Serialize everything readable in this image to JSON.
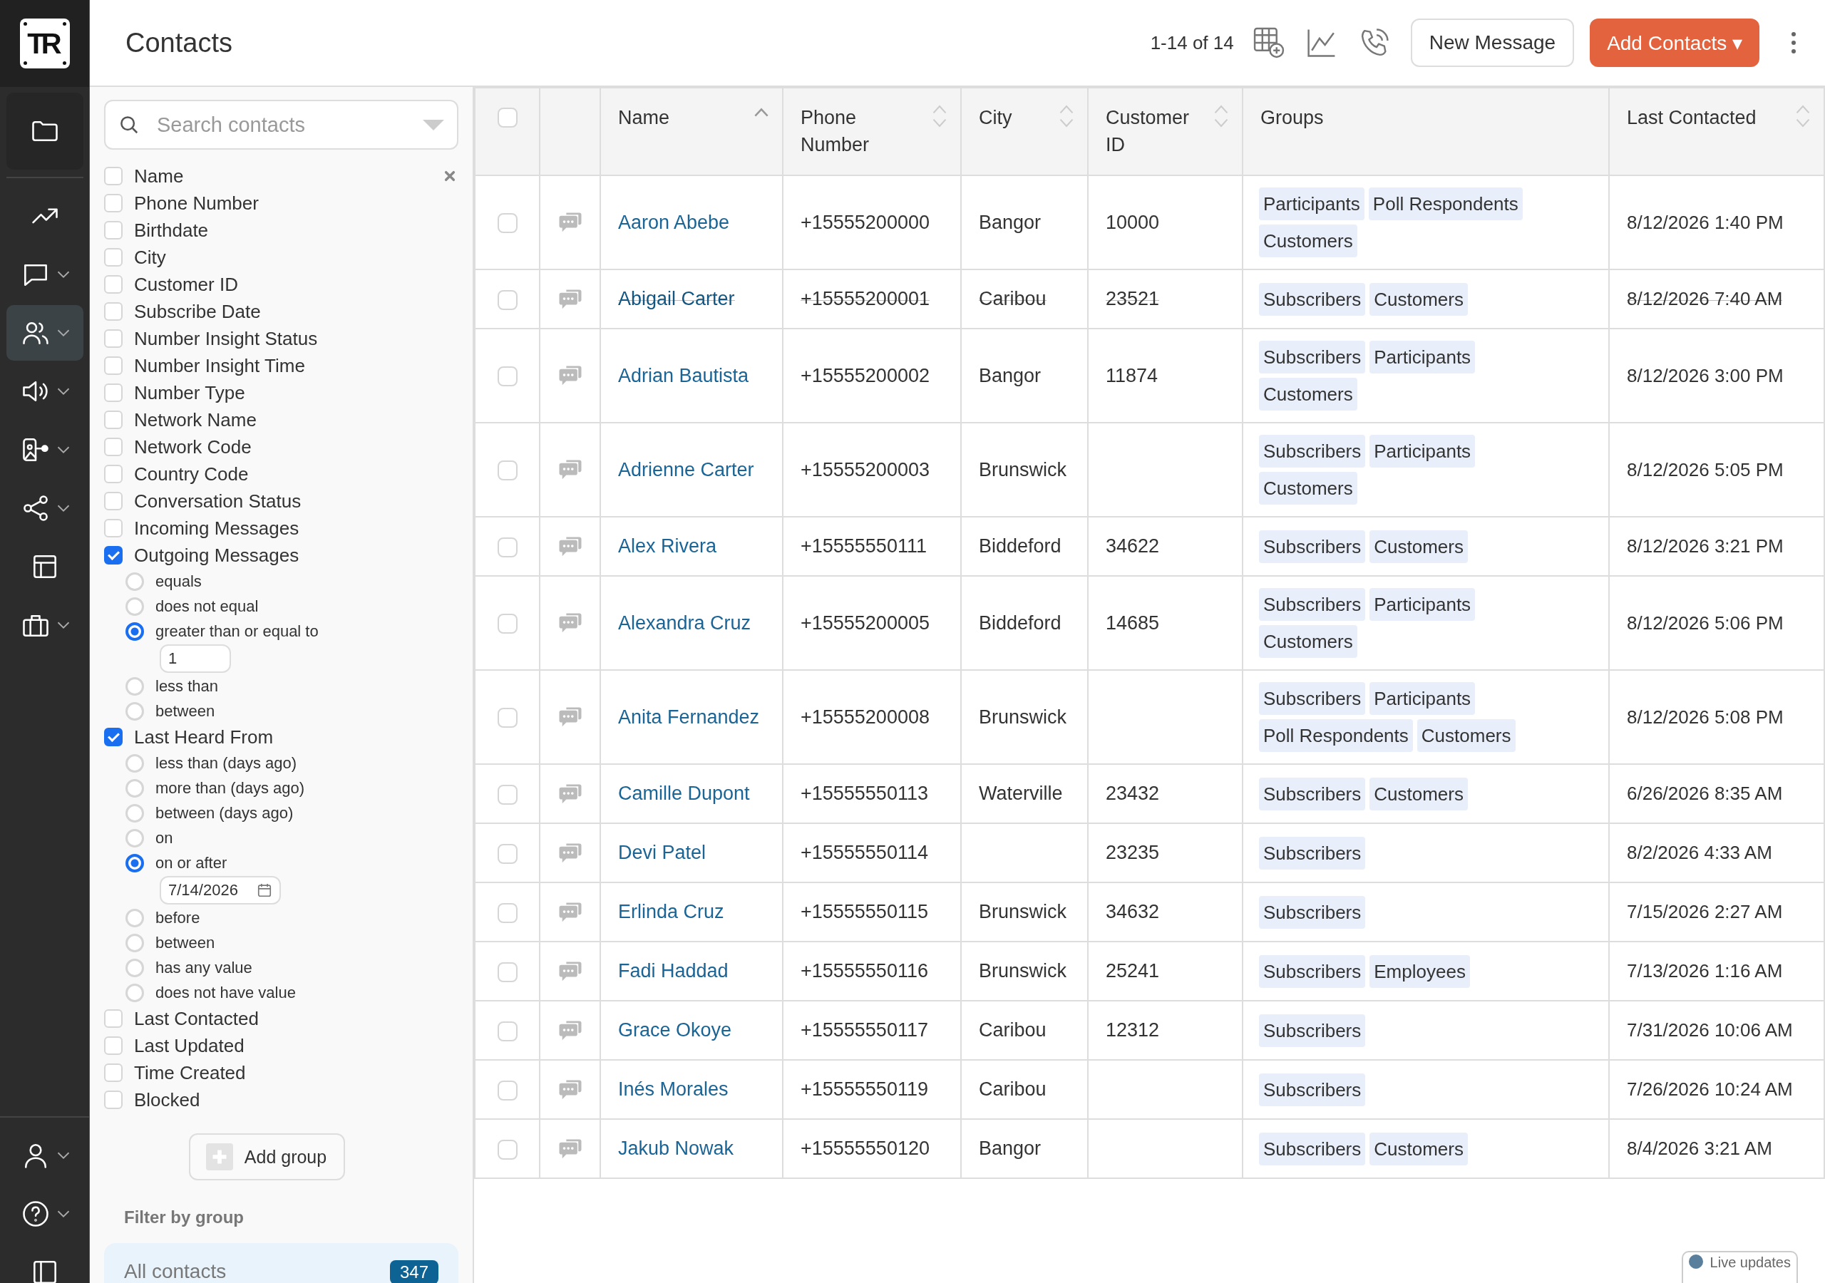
{
  "logo": "TR",
  "nav": [
    {
      "kind": "folder",
      "selected": false,
      "dropdown": false
    },
    {
      "kind": "trend",
      "selected": false,
      "dropdown": false
    },
    {
      "kind": "chat",
      "selected": false,
      "dropdown": true
    },
    {
      "kind": "people",
      "selected": true,
      "dropdown": true
    },
    {
      "kind": "speaker",
      "selected": false,
      "dropdown": true
    },
    {
      "kind": "board",
      "selected": false,
      "dropdown": true
    },
    {
      "kind": "share",
      "selected": false,
      "dropdown": true
    },
    {
      "kind": "table",
      "selected": false,
      "dropdown": false
    },
    {
      "kind": "briefcase",
      "selected": false,
      "dropdown": true
    }
  ],
  "nav_bottom": [
    {
      "kind": "user",
      "dropdown": true
    },
    {
      "kind": "help",
      "dropdown": true
    },
    {
      "kind": "panel",
      "dropdown": false
    }
  ],
  "header": {
    "title": "Contacts",
    "count": "1-14 of 14",
    "buttons": [
      {
        "label": "New Message",
        "kind": "secondary"
      },
      {
        "label": "Add Contacts ▾",
        "kind": "primary"
      }
    ]
  },
  "filters": {
    "search": {
      "placeholder": "Search contacts"
    },
    "fields": [
      {
        "label": "Name",
        "checked": false
      },
      {
        "label": "Phone Number",
        "checked": false
      },
      {
        "label": "Birthdate",
        "checked": false
      },
      {
        "label": "City",
        "checked": false
      },
      {
        "label": "Customer ID",
        "checked": false
      },
      {
        "label": "Subscribe Date",
        "checked": false
      },
      {
        "label": "Number Insight Status",
        "checked": false
      },
      {
        "label": "Number Insight Time",
        "checked": false
      },
      {
        "label": "Number Type",
        "checked": false
      },
      {
        "label": "Network Name",
        "checked": false
      },
      {
        "label": "Network Code",
        "checked": false
      },
      {
        "label": "Country Code",
        "checked": false
      },
      {
        "label": "Conversation Status",
        "checked": false
      },
      {
        "label": "Incoming Messages",
        "checked": false
      },
      {
        "label": "Outgoing Messages",
        "checked": true,
        "options": [
          {
            "label": "equals",
            "selected": false
          },
          {
            "label": "does not equal",
            "selected": false
          },
          {
            "label": "greater than or equal to",
            "selected": true,
            "input": {
              "kind": "number",
              "value": "1"
            }
          },
          {
            "label": "less than",
            "selected": false
          },
          {
            "label": "between",
            "selected": false
          }
        ]
      },
      {
        "label": "Last Heard From",
        "checked": true,
        "options": [
          {
            "label": "less than (days ago)",
            "selected": false
          },
          {
            "label": "more than (days ago)",
            "selected": false
          },
          {
            "label": "between (days ago)",
            "selected": false
          },
          {
            "label": "on",
            "selected": false
          },
          {
            "label": "on or after",
            "selected": true,
            "input": {
              "kind": "date",
              "value": "7/14/2026"
            }
          },
          {
            "label": "before",
            "selected": false
          },
          {
            "label": "between",
            "selected": false
          },
          {
            "label": "has any value",
            "selected": false
          },
          {
            "label": "does not have value",
            "selected": false
          }
        ]
      },
      {
        "label": "Last Contacted",
        "checked": false
      },
      {
        "label": "Last Updated",
        "checked": false
      },
      {
        "label": "Time Created",
        "checked": false
      },
      {
        "label": "Blocked",
        "checked": false
      }
    ],
    "add_group": "Add group",
    "group_heading": "Filter by group",
    "groups": [
      {
        "label": "All contacts",
        "count": "347",
        "selected": true
      }
    ]
  },
  "table": {
    "all_checked": false,
    "columns": [
      {
        "label": "Name",
        "sorted": true
      },
      {
        "label": "Phone Number",
        "sorted": false
      },
      {
        "label": "City",
        "sorted": false
      },
      {
        "label": "Customer ID",
        "sorted": false
      },
      {
        "label": "Groups"
      },
      {
        "label": "Last Contacted",
        "sorted": false
      }
    ],
    "rows": [
      {
        "checked": false,
        "blocked": false,
        "name": "Aaron Abebe",
        "phone": "+15555200000",
        "city": "Bangor",
        "customer_id": "10000",
        "groups": [
          "Participants",
          "Poll Respondents",
          "Customers"
        ],
        "last_contacted": "8/12/2026 1:40 PM"
      },
      {
        "checked": false,
        "blocked": true,
        "name": "Abigail Carter",
        "phone": "+15555200001",
        "city": "Caribou",
        "customer_id": "23521",
        "groups": [
          "Subscribers",
          "Customers"
        ],
        "last_contacted": "8/12/2026 7:40 AM"
      },
      {
        "checked": false,
        "blocked": false,
        "name": "Adrian Bautista",
        "phone": "+15555200002",
        "city": "Bangor",
        "customer_id": "11874",
        "groups": [
          "Subscribers",
          "Participants",
          "Customers"
        ],
        "last_contacted": "8/12/2026 3:00 PM"
      },
      {
        "checked": false,
        "blocked": false,
        "name": "Adrienne Carter",
        "phone": "+15555200003",
        "city": "Brunswick",
        "groups": [
          "Subscribers",
          "Participants",
          "Customers"
        ],
        "last_contacted": "8/12/2026 5:05 PM"
      },
      {
        "checked": false,
        "blocked": false,
        "name": "Alex Rivera",
        "phone": "+15555550111",
        "city": "Biddeford",
        "customer_id": "34622",
        "groups": [
          "Subscribers",
          "Customers"
        ],
        "last_contacted": "8/12/2026 3:21 PM"
      },
      {
        "checked": false,
        "blocked": false,
        "name": "Alexandra Cruz",
        "phone": "+15555200005",
        "city": "Biddeford",
        "customer_id": "14685",
        "groups": [
          "Subscribers",
          "Participants",
          "Customers"
        ],
        "last_contacted": "8/12/2026 5:06 PM"
      },
      {
        "checked": false,
        "blocked": false,
        "name": "Anita Fernandez",
        "phone": "+15555200008",
        "city": "Brunswick",
        "groups": [
          "Subscribers",
          "Participants",
          "Poll Respondents",
          "Customers"
        ],
        "last_contacted": "8/12/2026 5:08 PM"
      },
      {
        "checked": false,
        "blocked": false,
        "name": "Camille Dupont",
        "phone": "+15555550113",
        "city": "Waterville",
        "customer_id": "23432",
        "groups": [
          "Subscribers",
          "Customers"
        ],
        "last_contacted": "6/26/2026 8:35 AM"
      },
      {
        "checked": false,
        "blocked": false,
        "name": "Devi Patel",
        "phone": "+15555550114",
        "customer_id": "23235",
        "groups": [
          "Subscribers"
        ],
        "last_contacted": "8/2/2026 4:33 AM"
      },
      {
        "checked": false,
        "blocked": false,
        "name": "Erlinda Cruz",
        "phone": "+15555550115",
        "city": "Brunswick",
        "customer_id": "34632",
        "groups": [
          "Subscribers"
        ],
        "last_contacted": "7/15/2026 2:27 AM"
      },
      {
        "checked": false,
        "blocked": false,
        "name": "Fadi Haddad",
        "phone": "+15555550116",
        "city": "Brunswick",
        "customer_id": "25241",
        "groups": [
          "Subscribers",
          "Employees"
        ],
        "last_contacted": "7/13/2026 1:16 AM"
      },
      {
        "checked": false,
        "blocked": false,
        "name": "Grace Okoye",
        "phone": "+15555550117",
        "city": "Caribou",
        "customer_id": "12312",
        "groups": [
          "Subscribers"
        ],
        "last_contacted": "7/31/2026 10:06 AM"
      },
      {
        "checked": false,
        "blocked": false,
        "name": "Inés Morales",
        "phone": "+15555550119",
        "city": "Caribou",
        "groups": [
          "Subscribers"
        ],
        "last_contacted": "7/26/2026 10:24 AM"
      },
      {
        "checked": false,
        "blocked": false,
        "name": "Jakub Nowak",
        "phone": "+15555550120",
        "city": "Bangor",
        "groups": [
          "Subscribers",
          "Customers"
        ],
        "last_contacted": "8/4/2026 3:21 AM"
      }
    ]
  },
  "live_updates": "Live updates"
}
